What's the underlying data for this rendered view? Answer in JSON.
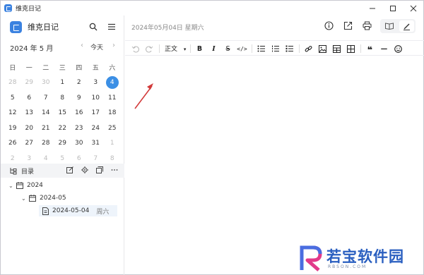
{
  "window": {
    "title": "维克日记",
    "controls": [
      "minimize",
      "maximize",
      "close"
    ]
  },
  "sidebar": {
    "app_name": "维克日记",
    "month_label": "2024 年 5 月",
    "today_label": "今天",
    "weekdays": [
      "日",
      "一",
      "二",
      "三",
      "四",
      "五",
      "六"
    ],
    "weeks": [
      [
        "28",
        "29",
        "30",
        "1",
        "2",
        "3",
        "4"
      ],
      [
        "5",
        "6",
        "7",
        "8",
        "9",
        "10",
        "11"
      ],
      [
        "12",
        "13",
        "14",
        "15",
        "16",
        "17",
        "18"
      ],
      [
        "19",
        "20",
        "21",
        "22",
        "23",
        "24",
        "25"
      ],
      [
        "26",
        "27",
        "28",
        "29",
        "30",
        "31",
        "1"
      ],
      [
        "2",
        "3",
        "4",
        "5",
        "6",
        "7",
        "8"
      ]
    ],
    "selected_day": "4",
    "directory_label": "目录",
    "tree": {
      "year": "2024",
      "month": "2024-05",
      "entry": {
        "date": "2024-05-04",
        "weekday": "周六"
      }
    }
  },
  "main": {
    "date_title": "2024年05月04日 星期六",
    "paragraph_style": "正文",
    "toolbar_labels": {
      "bold": "B",
      "italic": "I",
      "strike": "S",
      "code": "</>",
      "quote": "❝",
      "hr": "—"
    }
  },
  "watermark": {
    "text": "若宝软件园",
    "sub": "RBSON.COM"
  },
  "colors": {
    "accent": "#3b8fe5",
    "arrow": "#d23a3a",
    "watermark": "#2a5fc0"
  },
  "icons": [
    "search-icon",
    "menu-icon",
    "info-icon",
    "export-icon",
    "print-icon",
    "read-mode-icon",
    "edit-mode-icon",
    "undo-icon",
    "redo-icon",
    "link-icon",
    "image-icon",
    "table-icon",
    "grid-icon",
    "emoji-icon"
  ]
}
